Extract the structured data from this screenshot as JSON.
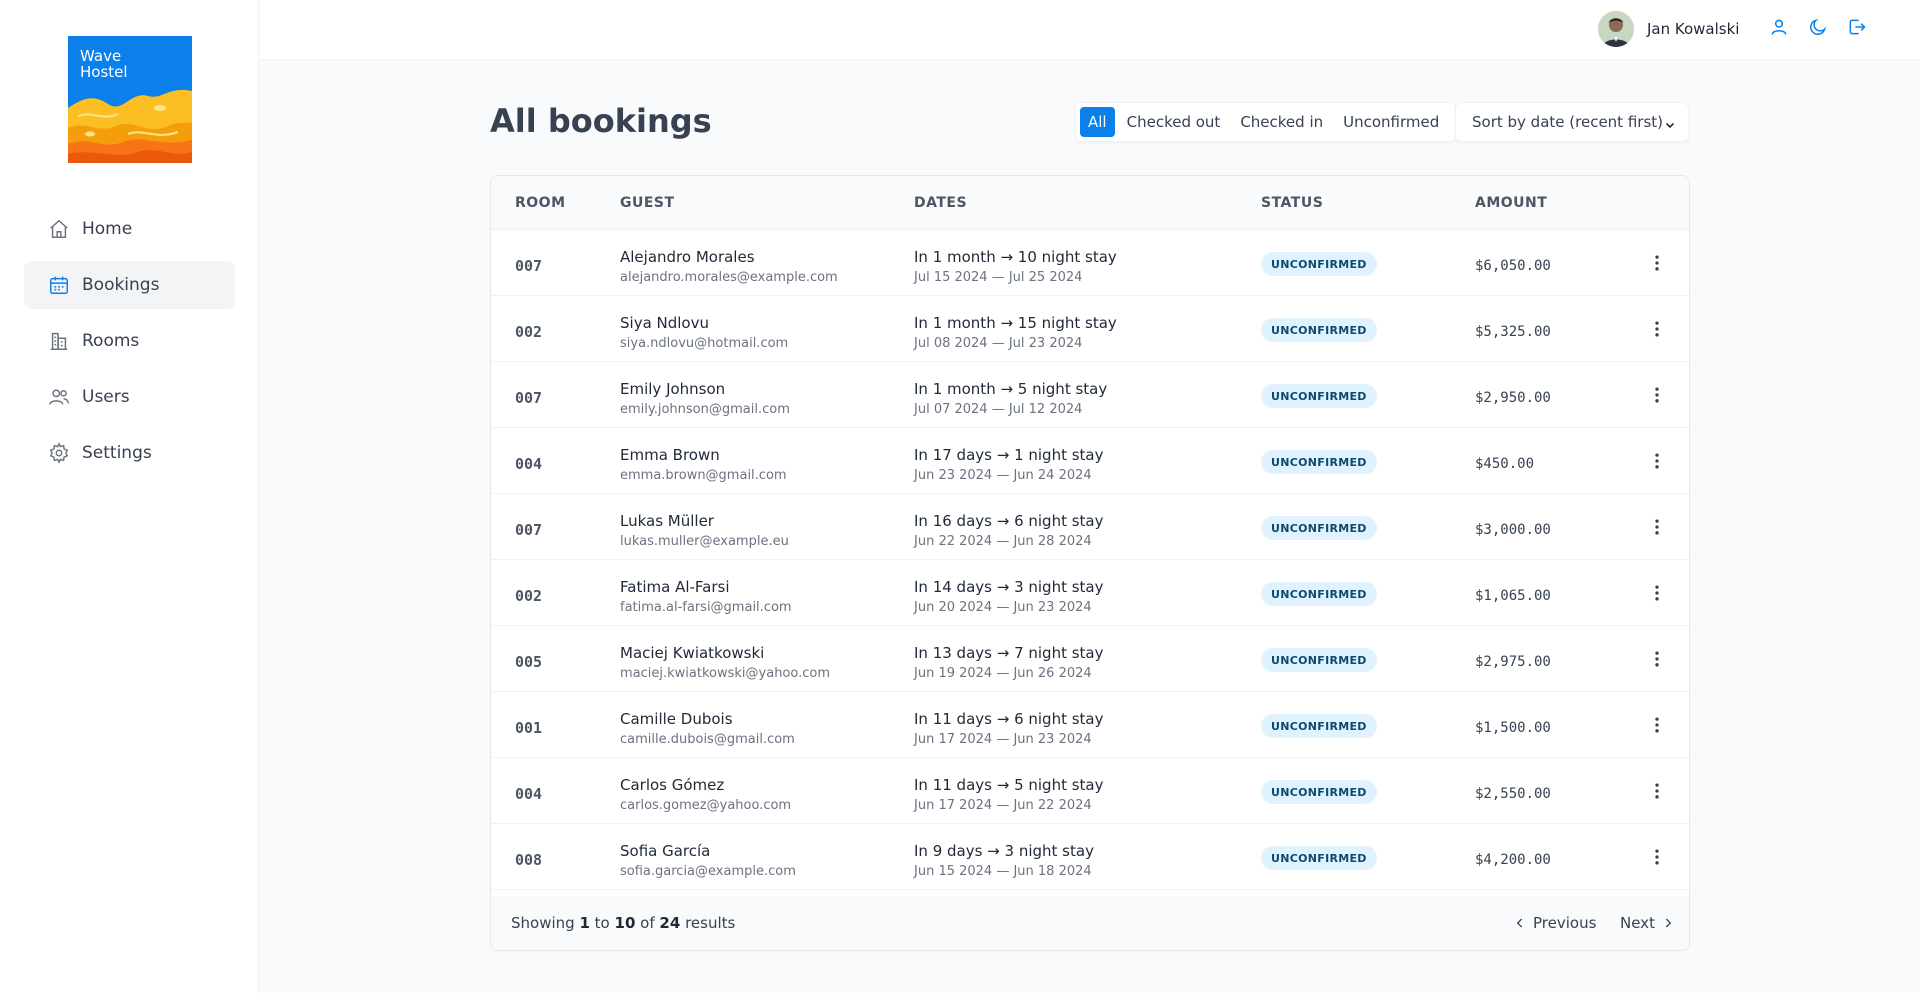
{
  "app": {
    "logo_line1": "Wave",
    "logo_line2": "Hostel",
    "brand_color": "#0b7fea"
  },
  "sidebar": {
    "items": [
      {
        "label": "Home",
        "icon": "home-icon",
        "active": false
      },
      {
        "label": "Bookings",
        "icon": "calendar-icon",
        "active": true
      },
      {
        "label": "Rooms",
        "icon": "building-icon",
        "active": false
      },
      {
        "label": "Users",
        "icon": "users-icon",
        "active": false
      },
      {
        "label": "Settings",
        "icon": "gear-icon",
        "active": false
      }
    ]
  },
  "header": {
    "user_name": "Jan Kowalski",
    "icons": [
      "user-icon",
      "moon-icon",
      "logout-icon"
    ]
  },
  "main": {
    "title": "All bookings",
    "filters": [
      "All",
      "Checked out",
      "Checked in",
      "Unconfirmed"
    ],
    "active_filter": "All",
    "sort_label": "Sort by date (recent first)"
  },
  "table": {
    "headers": {
      "room": "ROOM",
      "guest": "GUEST",
      "dates": "DATES",
      "status": "STATUS",
      "amount": "AMOUNT"
    },
    "rows": [
      {
        "room": "007",
        "name": "Alejandro Morales",
        "email": "alejandro.morales@example.com",
        "dates": "In 1 month → 10 night stay",
        "range": "Jul 15 2024 — Jul 25 2024",
        "status": "UNCONFIRMED",
        "amount": "$6,050.00"
      },
      {
        "room": "002",
        "name": "Siya Ndlovu",
        "email": "siya.ndlovu@hotmail.com",
        "dates": "In 1 month → 15 night stay",
        "range": "Jul 08 2024 — Jul 23 2024",
        "status": "UNCONFIRMED",
        "amount": "$5,325.00"
      },
      {
        "room": "007",
        "name": "Emily Johnson",
        "email": "emily.johnson@gmail.com",
        "dates": "In 1 month → 5 night stay",
        "range": "Jul 07 2024 — Jul 12 2024",
        "status": "UNCONFIRMED",
        "amount": "$2,950.00"
      },
      {
        "room": "004",
        "name": "Emma Brown",
        "email": "emma.brown@gmail.com",
        "dates": "In 17 days → 1 night stay",
        "range": "Jun 23 2024 — Jun 24 2024",
        "status": "UNCONFIRMED",
        "amount": "$450.00"
      },
      {
        "room": "007",
        "name": "Lukas Müller",
        "email": "lukas.muller@example.eu",
        "dates": "In 16 days → 6 night stay",
        "range": "Jun 22 2024 — Jun 28 2024",
        "status": "UNCONFIRMED",
        "amount": "$3,000.00"
      },
      {
        "room": "002",
        "name": "Fatima Al-Farsi",
        "email": "fatima.al-farsi@gmail.com",
        "dates": "In 14 days → 3 night stay",
        "range": "Jun 20 2024 — Jun 23 2024",
        "status": "UNCONFIRMED",
        "amount": "$1,065.00"
      },
      {
        "room": "005",
        "name": "Maciej Kwiatkowski",
        "email": "maciej.kwiatkowski@yahoo.com",
        "dates": "In 13 days → 7 night stay",
        "range": "Jun 19 2024 — Jun 26 2024",
        "status": "UNCONFIRMED",
        "amount": "$2,975.00"
      },
      {
        "room": "001",
        "name": "Camille Dubois",
        "email": "camille.dubois@gmail.com",
        "dates": "In 11 days → 6 night stay",
        "range": "Jun 17 2024 — Jun 23 2024",
        "status": "UNCONFIRMED",
        "amount": "$1,500.00"
      },
      {
        "room": "004",
        "name": "Carlos Gómez",
        "email": "carlos.gomez@yahoo.com",
        "dates": "In 11 days → 5 night stay",
        "range": "Jun 17 2024 — Jun 22 2024",
        "status": "UNCONFIRMED",
        "amount": "$2,550.00"
      },
      {
        "room": "008",
        "name": "Sofia García",
        "email": "sofia.garcia@example.com",
        "dates": "In 9 days → 3 night stay",
        "range": "Jun 15 2024 — Jun 18 2024",
        "status": "UNCONFIRMED",
        "amount": "$4,200.00"
      }
    ]
  },
  "pagination": {
    "prefix": "Showing",
    "from": "1",
    "to_word": "to",
    "to": "10",
    "of_word": "of",
    "total": "24",
    "suffix": "results",
    "prev_label": "Previous",
    "next_label": "Next"
  }
}
